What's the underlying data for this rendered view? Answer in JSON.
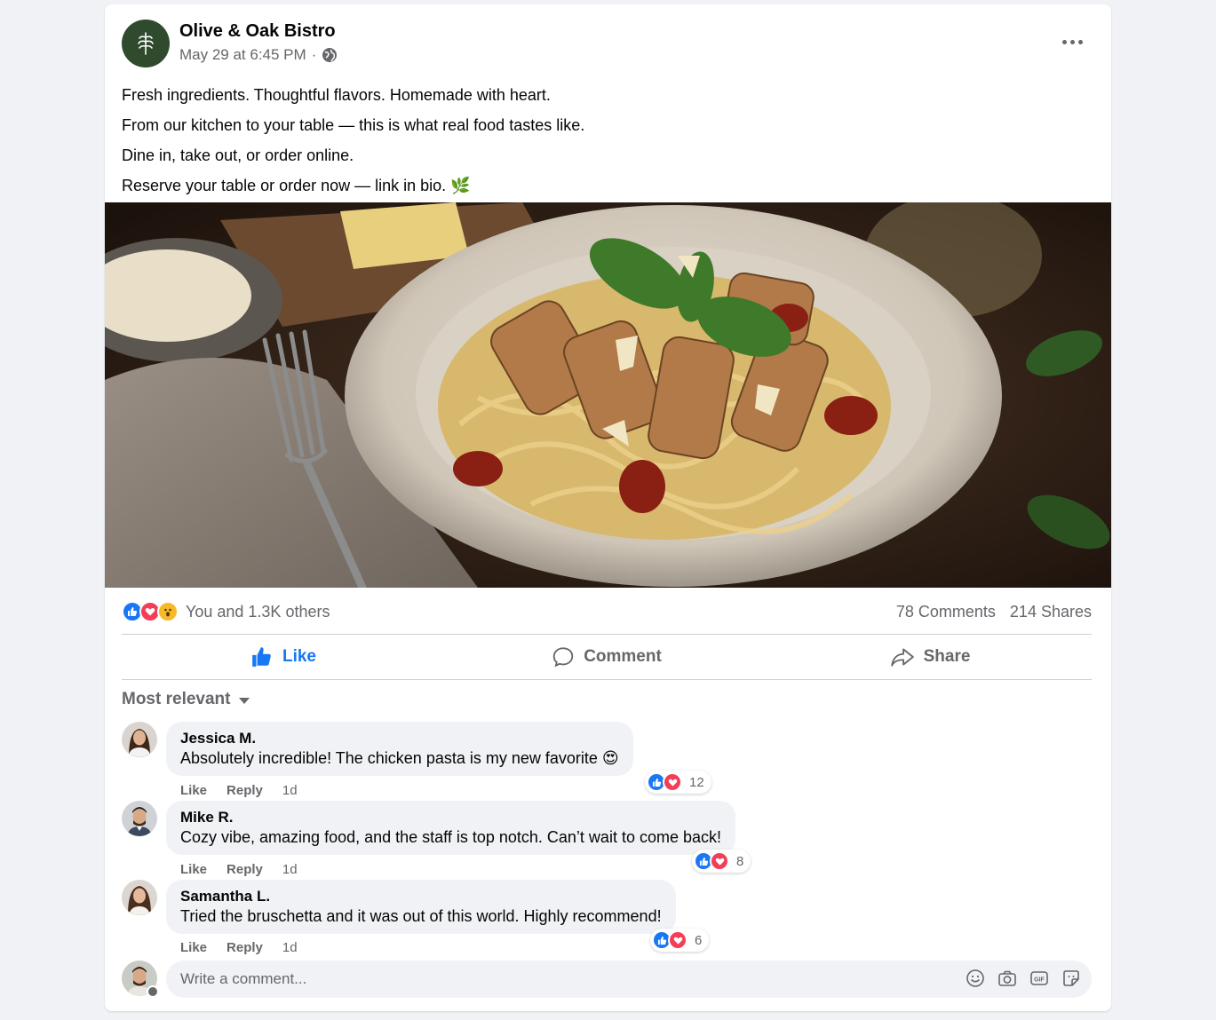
{
  "post": {
    "page_name": "Olive & Oak Bistro",
    "timestamp": "May 29 at 6:45 PM",
    "separator": "·",
    "audience_icon": "globe-icon",
    "caption_lines": [
      "Fresh ingredients. Thoughtful flavors. Homemade with heart.",
      "From our kitchen to your table — this is what real food tastes like.",
      "Dine in, take out, or order online.",
      "Reserve your table or order now — link in bio. 🌿"
    ]
  },
  "stats": {
    "reaction_icons": [
      "like-icon",
      "love-icon",
      "wow-icon"
    ],
    "reaction_text": "You and 1.3K others",
    "comments": "78 Comments",
    "shares": "214 Shares"
  },
  "actions": {
    "like": "Like",
    "comment": "Comment",
    "share": "Share"
  },
  "sort_label": "Most relevant",
  "comments": [
    {
      "name": "Jessica M.",
      "text": "Absolutely incredible! The chicken pasta is my new favorite 😍",
      "like": "Like",
      "reply": "Reply",
      "time": "1d",
      "reactions": "12"
    },
    {
      "name": "Mike R.",
      "text": "Cozy vibe, amazing food, and the staff is top notch. Can’t wait to come back!",
      "like": "Like",
      "reply": "Reply",
      "time": "1d",
      "reactions": "8"
    },
    {
      "name": "Samantha L.",
      "text": "Tried the bruschetta and it was out of this world. Highly recommend!",
      "like": "Like",
      "reply": "Reply",
      "time": "1d",
      "reactions": "6"
    }
  ],
  "composer": {
    "placeholder": "Write a comment...",
    "tools": [
      "emoji-icon",
      "camera-icon",
      "gif-icon",
      "sticker-icon"
    ]
  },
  "colors": {
    "accent": "#1877f2",
    "love": "#f33e58",
    "secondary_text": "#65676b",
    "page_avatar": "#2f4a2c"
  }
}
